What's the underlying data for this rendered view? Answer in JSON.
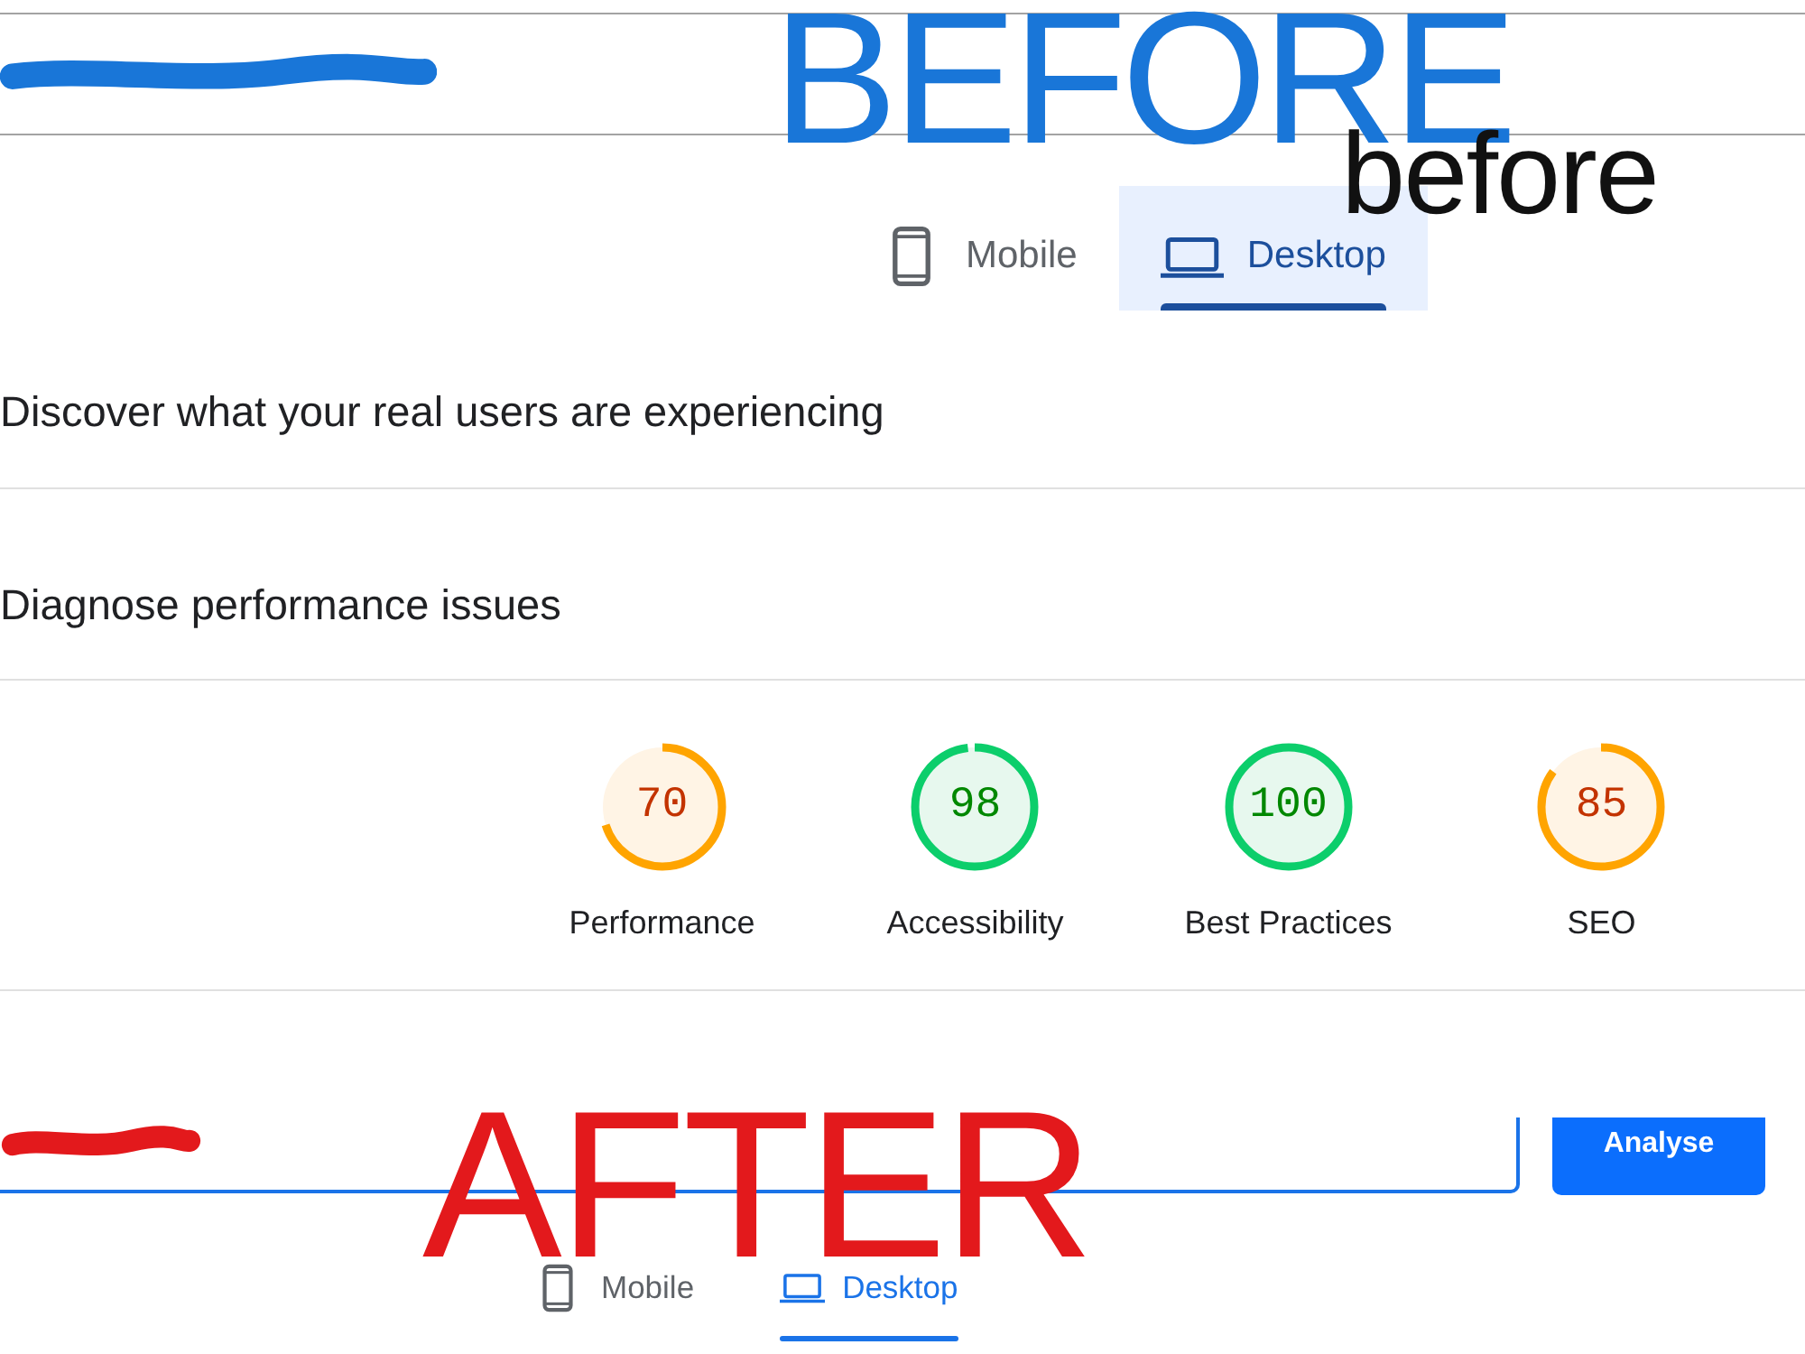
{
  "before_screen": {
    "annotations": [
      {
        "kind": "scribble",
        "color": "#1976d8"
      },
      {
        "kind": "handwritten",
        "text": "BEFORE",
        "color": "#1976d8"
      },
      {
        "kind": "typed",
        "text": "before",
        "color": "#111111"
      }
    ],
    "tabs": [
      {
        "kind": "mobile",
        "label": "Mobile",
        "selected": false
      },
      {
        "kind": "desktop",
        "label": "Desktop",
        "selected": true
      }
    ],
    "sections": [
      {
        "title": "Discover what your real users are experiencing"
      },
      {
        "title": "Diagnose performance issues"
      }
    ],
    "gauges": [
      {
        "kind": "average",
        "score": "70",
        "level": 0.7,
        "label": "Performance"
      },
      {
        "kind": "pass",
        "score": "98",
        "level": 0.98,
        "label": "Accessibility"
      },
      {
        "kind": "pass",
        "score": "100",
        "level": 1,
        "label": "Best Practices"
      },
      {
        "kind": "average",
        "score": "85",
        "level": 0.85,
        "label": "SEO"
      }
    ]
  },
  "after_screen": {
    "annotations": [
      {
        "kind": "scribble",
        "color": "#e3191c"
      },
      {
        "kind": "handwritten",
        "text": "AFTER",
        "color": "#e3191c"
      }
    ],
    "button": "Analyse",
    "tabs": [
      {
        "kind": "mobile",
        "label": "Mobile",
        "selected": false
      },
      {
        "kind": "desktop",
        "label": "Desktop",
        "selected": true
      }
    ]
  }
}
